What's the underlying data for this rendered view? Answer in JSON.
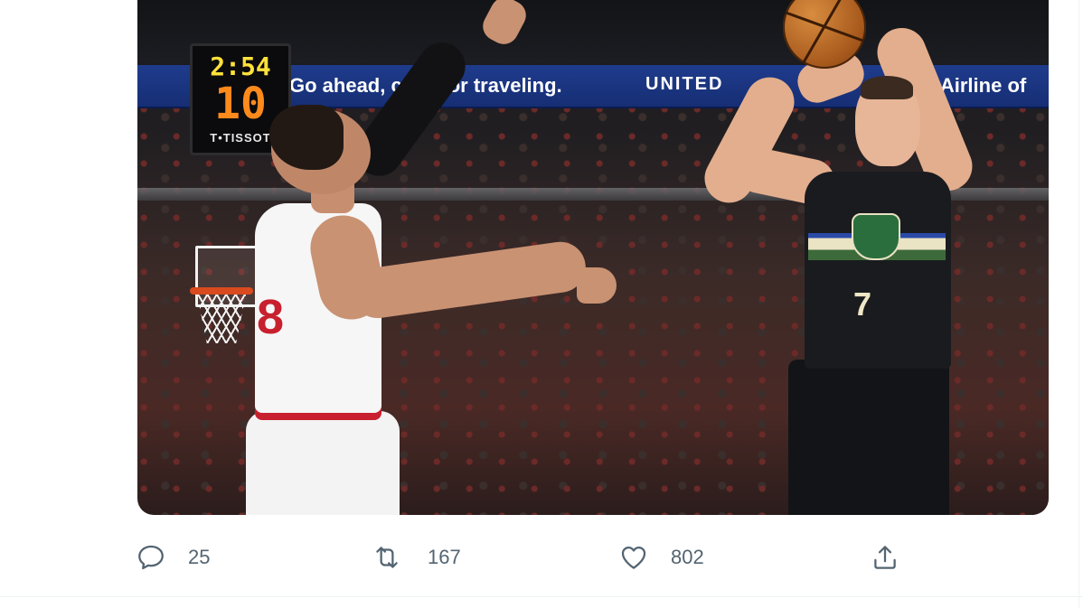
{
  "tweet": {
    "media": {
      "alt": "",
      "scene": {
        "shot_clock": {
          "game_time": "2:54",
          "shot_time": "10",
          "brand": "T•TISSOT"
        },
        "ribbon": {
          "segment_1": "Go ahead, cal■ ■or traveling.",
          "segment_2": "UNITED",
          "segment_3": "Official Airline of"
        },
        "player_left_number": "8",
        "player_right_number": "7"
      }
    },
    "actions": {
      "reply": {
        "icon": "reply-icon",
        "count": "25"
      },
      "retweet": {
        "icon": "retweet-icon",
        "count": "167"
      },
      "like": {
        "icon": "heart-icon",
        "count": "802"
      },
      "share": {
        "icon": "share-icon"
      }
    }
  },
  "colors": {
    "action_gray": "#536471",
    "divider": "#eff3f4",
    "ribbon_blue": "#1f3b8c"
  }
}
